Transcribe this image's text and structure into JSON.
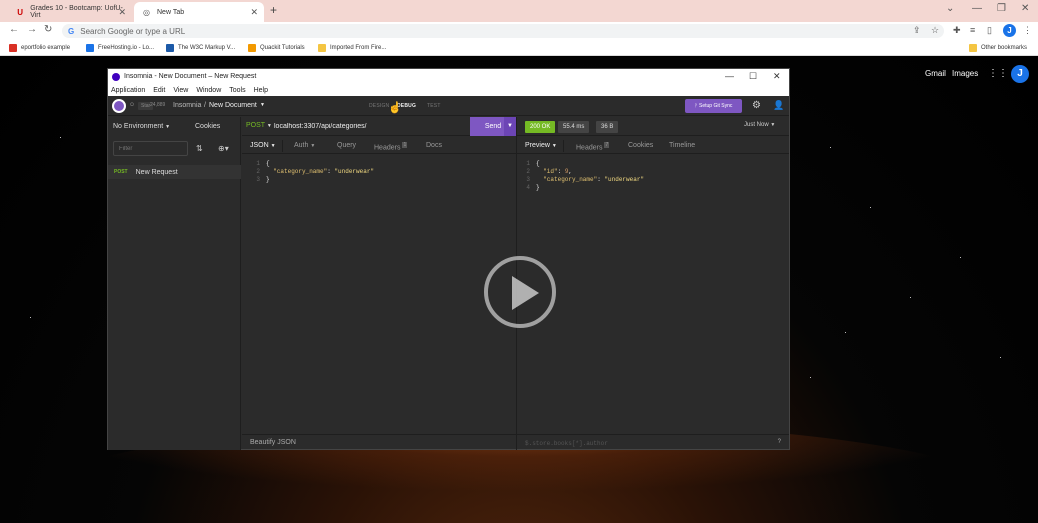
{
  "browser": {
    "tabs": [
      {
        "title": "Grades 10 - Bootcamp: UofU-Virt"
      },
      {
        "title": "New Tab"
      }
    ],
    "omnibox_placeholder": "Search Google or type a URL",
    "profile_initial": "J",
    "bookmarks": [
      {
        "label": "eportfolio example",
        "color": "#d93025"
      },
      {
        "label": "FreeHosting.io - Lo...",
        "color": "#1a73e8"
      },
      {
        "label": "The W3C Markup V...",
        "color": "#1c5aa8"
      },
      {
        "label": "Quackit Tutorials",
        "color": "#f29900"
      },
      {
        "label": "Imported From Fire...",
        "color": "#f4c542"
      },
      {
        "label": "Other bookmarks",
        "color": "#f4c542"
      }
    ]
  },
  "newtab": {
    "gmail": "Gmail",
    "images": "Images",
    "avatar_initial": "J"
  },
  "insomnia": {
    "window_title": "Insomnia - New Document – New Request",
    "menu": [
      "Application",
      "Edit",
      "View",
      "Window",
      "Tools",
      "Help"
    ],
    "plan_badge": "Star",
    "plan_count": "24,889",
    "breadcrumb_root": "Insomnia",
    "breadcrumb_sep": "/",
    "document": "New Document",
    "modes": [
      "DESIGN",
      "DEBUG",
      "TEST"
    ],
    "active_mode": "DEBUG",
    "git_sync": "Setup Git Sync",
    "sidebar": {
      "environment": "No Environment",
      "cookies": "Cookies",
      "filter_placeholder": "Filter",
      "requests": [
        {
          "method": "POST",
          "name": "New Request"
        }
      ]
    },
    "request": {
      "method": "POST",
      "url": "localhost:3307/api/categories/",
      "send": "Send",
      "tabs": [
        "JSON",
        "Auth",
        "Query",
        "Headers",
        "Docs"
      ],
      "headers_count": "1",
      "body_lines": [
        {
          "n": "1",
          "text": "{"
        },
        {
          "n": "2",
          "key": "\"category_name\"",
          "value": "\"underwear\""
        },
        {
          "n": "3",
          "text": "}"
        }
      ],
      "footer": "Beautify JSON"
    },
    "response": {
      "status": "200 OK",
      "time": "55.4 ms",
      "size": "36 B",
      "timestamp": "Just Now",
      "tabs": [
        "Preview",
        "Headers",
        "Cookies",
        "Timeline"
      ],
      "headers_count": "7",
      "body_lines": [
        {
          "n": "1",
          "text": "{"
        },
        {
          "n": "2",
          "key": "\"id\"",
          "value": "9"
        },
        {
          "n": "3",
          "key": "\"category_name\"",
          "value": "\"underwear\""
        },
        {
          "n": "4",
          "text": "}"
        }
      ],
      "filter_placeholder": "$.store.books[*].author"
    }
  },
  "colors": {
    "accent": "#7e57c2",
    "success": "#75ba24"
  }
}
